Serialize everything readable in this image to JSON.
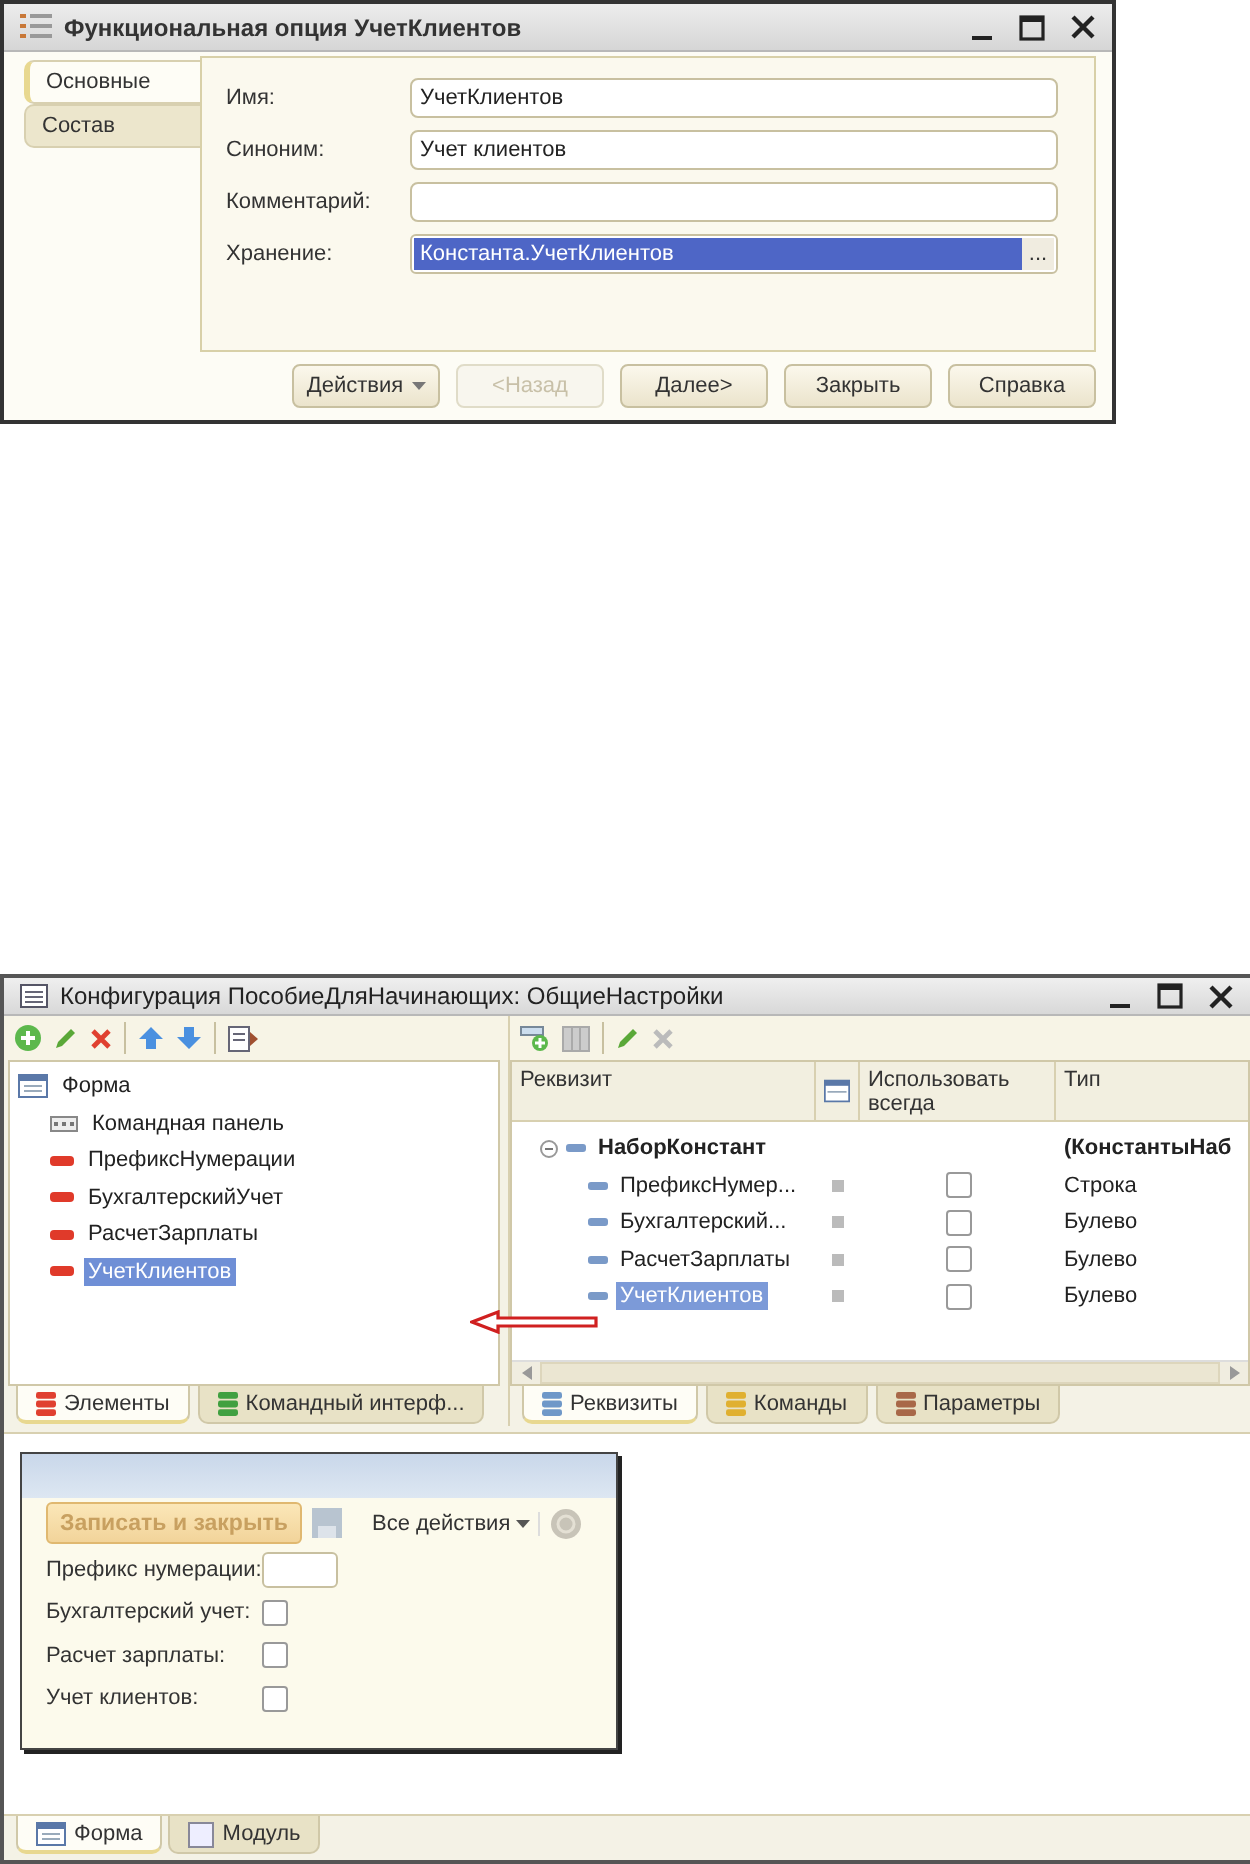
{
  "dialog": {
    "title": "Функциональная опция УчетКлиентов",
    "tabs": [
      {
        "label": "Основные",
        "selected": true
      },
      {
        "label": "Состав",
        "selected": false
      }
    ],
    "fields": [
      {
        "label": "Имя:",
        "value": "УчетКлиентов",
        "kind": "text",
        "selected": false
      },
      {
        "label": "Синоним:",
        "value": "Учет клиентов",
        "kind": "text",
        "selected": false
      },
      {
        "label": "Комментарий:",
        "kind": "text",
        "selected": false
      },
      {
        "label": "Хранение:",
        "value": "Константа.УчетКлиентов",
        "kind": "choice",
        "button": "...",
        "selected": true
      }
    ],
    "buttons": [
      {
        "label": "Действия",
        "kind": "menu",
        "disabled": false
      },
      {
        "label": "<Назад",
        "kind": "plain",
        "disabled": true
      },
      {
        "label": "Далее>",
        "kind": "plain",
        "disabled": false
      },
      {
        "label": "Закрыть",
        "kind": "plain",
        "disabled": false
      },
      {
        "label": "Справка",
        "kind": "plain",
        "disabled": false
      }
    ]
  },
  "config": {
    "title": "Конфигурация ПособиеДляНачинающих: ОбщиеНастройки",
    "tree": [
      {
        "label": "Форма",
        "kind": "form",
        "selected": false,
        "children": [
          {
            "label": "Командная панель",
            "kind": "command_bar",
            "selected": false
          },
          {
            "label": "ПрефиксНумерации",
            "kind": "field",
            "selected": false
          },
          {
            "label": "БухгалтерскийУчет",
            "kind": "field",
            "selected": false
          },
          {
            "label": "РасчетЗарплаты",
            "kind": "field",
            "selected": false
          },
          {
            "label": "УчетКлиентов",
            "kind": "field",
            "selected": true
          }
        ]
      }
    ],
    "left_tabs": [
      {
        "label": "Элементы",
        "selected": true,
        "color": "#e04030"
      },
      {
        "label": "Командный интерф...",
        "selected": false,
        "color": "#40a040"
      }
    ],
    "table": {
      "columns": [
        "Реквизит",
        "Использовать всегда",
        "Тип"
      ],
      "rows": [
        {
          "name": "НаборКонстант",
          "type": "(КонстантыНаб",
          "expanded": true,
          "selected": false,
          "children": [
            {
              "name": "ПрефиксНумер...",
              "use_always": false,
              "type": "Строка",
              "selected": false
            },
            {
              "name": "Бухгалтерский...",
              "use_always": false,
              "type": "Булево",
              "selected": false
            },
            {
              "name": "РасчетЗарплаты",
              "use_always": false,
              "type": "Булево",
              "selected": false
            },
            {
              "name": "УчетКлиентов",
              "use_always": false,
              "type": "Булево",
              "selected": true
            }
          ]
        }
      ]
    },
    "right_tabs": [
      {
        "label": "Реквизиты",
        "selected": true,
        "color": "#6f98c8"
      },
      {
        "label": "Команды",
        "selected": false,
        "color": "#e0b030"
      },
      {
        "label": "Параметры",
        "selected": false,
        "color": "#a86848"
      }
    ],
    "form_preview": {
      "save_button": "Записать и закрыть",
      "actions_menu": "Все действия",
      "fields": [
        {
          "label": "Префикс нумерации:",
          "kind": "input"
        },
        {
          "label": "Бухгалтерский учет:",
          "kind": "checkbox",
          "checked": false
        },
        {
          "label": "Расчет зарплаты:",
          "kind": "checkbox",
          "checked": false
        },
        {
          "label": "Учет клиентов:",
          "kind": "checkbox",
          "checked": false
        }
      ]
    },
    "bottom_tabs": [
      {
        "label": "Форма",
        "selected": true,
        "kind": "form"
      },
      {
        "label": "Модуль",
        "selected": false,
        "kind": "module"
      }
    ]
  }
}
